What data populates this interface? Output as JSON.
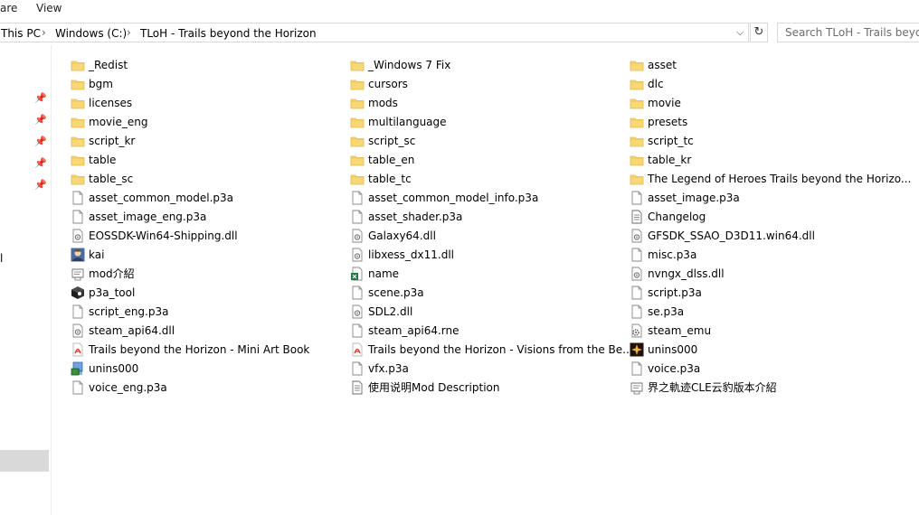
{
  "ribbon": {
    "tab_share": "are",
    "tab_view": "View"
  },
  "address": {
    "crumbs": [
      "This PC",
      "Windows (C:)",
      "TLoH - Trails beyond the Horizon"
    ],
    "separator": "›",
    "dropdown": "⌵",
    "refresh": "↻"
  },
  "search": {
    "placeholder": "Search TLoH - Trails beyond the Horizon"
  },
  "nav": {
    "fragment": "l"
  },
  "files": [
    {
      "label": "_Redist",
      "icon": "folder"
    },
    {
      "label": "_Windows 7 Fix",
      "icon": "folder"
    },
    {
      "label": "asset",
      "icon": "folder"
    },
    {
      "label": "bgm",
      "icon": "folder"
    },
    {
      "label": "cursors",
      "icon": "folder"
    },
    {
      "label": "dlc",
      "icon": "folder"
    },
    {
      "label": "licenses",
      "icon": "folder"
    },
    {
      "label": "mods",
      "icon": "folder"
    },
    {
      "label": "movie",
      "icon": "folder"
    },
    {
      "label": "movie_eng",
      "icon": "folder"
    },
    {
      "label": "multilanguage",
      "icon": "folder"
    },
    {
      "label": "presets",
      "icon": "folder"
    },
    {
      "label": "script_kr",
      "icon": "folder"
    },
    {
      "label": "script_sc",
      "icon": "folder"
    },
    {
      "label": "script_tc",
      "icon": "folder"
    },
    {
      "label": "table",
      "icon": "folder"
    },
    {
      "label": "table_en",
      "icon": "folder"
    },
    {
      "label": "table_kr",
      "icon": "folder"
    },
    {
      "label": "table_sc",
      "icon": "folder"
    },
    {
      "label": "table_tc",
      "icon": "folder"
    },
    {
      "label": "The Legend of Heroes Trails beyond the Horizo...",
      "icon": "folder"
    },
    {
      "label": "asset_common_model.p3a",
      "icon": "file"
    },
    {
      "label": "asset_common_model_info.p3a",
      "icon": "file"
    },
    {
      "label": "asset_image.p3a",
      "icon": "file"
    },
    {
      "label": "asset_image_eng.p3a",
      "icon": "file"
    },
    {
      "label": "asset_shader.p3a",
      "icon": "file"
    },
    {
      "label": "Changelog",
      "icon": "text"
    },
    {
      "label": "EOSSDK-Win64-Shipping.dll",
      "icon": "dll"
    },
    {
      "label": "Galaxy64.dll",
      "icon": "dll"
    },
    {
      "label": "GFSDK_SSAO_D3D11.win64.dll",
      "icon": "dll"
    },
    {
      "label": "kai",
      "icon": "avatar"
    },
    {
      "label": "libxess_dx11.dll",
      "icon": "dll"
    },
    {
      "label": "misc.p3a",
      "icon": "file"
    },
    {
      "label": "mod介紹",
      "icon": "info"
    },
    {
      "label": "name",
      "icon": "excel"
    },
    {
      "label": "nvngx_dlss.dll",
      "icon": "dll"
    },
    {
      "label": "p3a_tool",
      "icon": "cube"
    },
    {
      "label": "scene.p3a",
      "icon": "file"
    },
    {
      "label": "script.p3a",
      "icon": "file"
    },
    {
      "label": "script_eng.p3a",
      "icon": "file"
    },
    {
      "label": "SDL2.dll",
      "icon": "dll"
    },
    {
      "label": "se.p3a",
      "icon": "file"
    },
    {
      "label": "steam_api64.dll",
      "icon": "dll"
    },
    {
      "label": "steam_api64.rne",
      "icon": "file"
    },
    {
      "label": "steam_emu",
      "icon": "settings"
    },
    {
      "label": "Trails beyond the Horizon - Mini Art Book",
      "icon": "pdf"
    },
    {
      "label": "Trails beyond the Horizon - Visions from the Be...",
      "icon": "pdf"
    },
    {
      "label": "unins000",
      "icon": "game"
    },
    {
      "label": "unins000",
      "icon": "setup"
    },
    {
      "label": "vfx.p3a",
      "icon": "file"
    },
    {
      "label": "voice.p3a",
      "icon": "file"
    },
    {
      "label": "voice_eng.p3a",
      "icon": "file"
    },
    {
      "label": "使用说明Mod Description",
      "icon": "text"
    },
    {
      "label": "界之軌迹CLE云豹版本介紹",
      "icon": "info"
    }
  ],
  "colors": {
    "folder": "#f8d775",
    "folder_dark": "#e4b84a",
    "pdf": "#d93025",
    "excel": "#1d7a43",
    "nav_selected": "#d9d9d9"
  }
}
